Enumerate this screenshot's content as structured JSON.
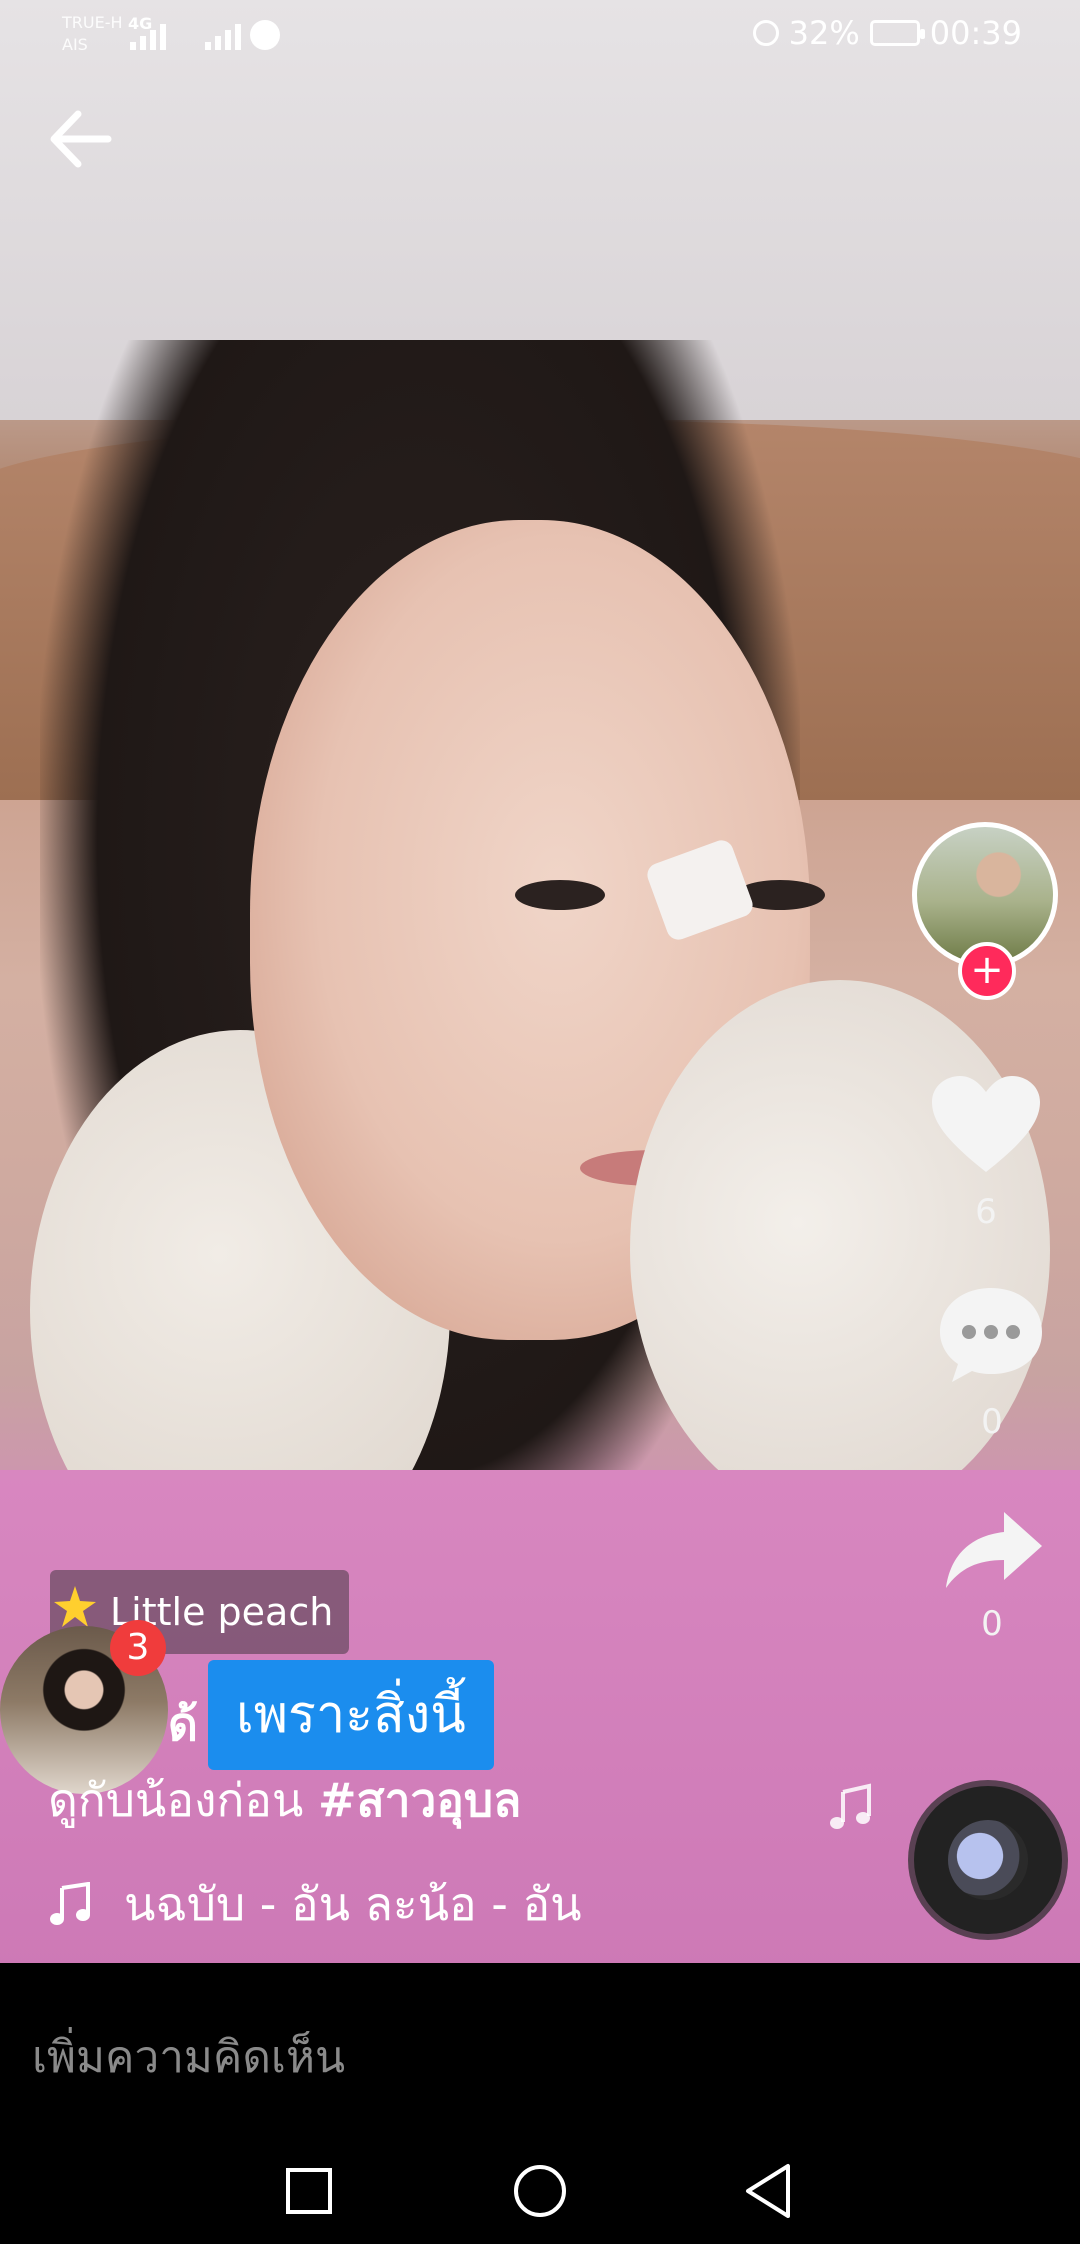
{
  "status_bar": {
    "carrier_1": "TRUE-H",
    "carrier_2": "AIS",
    "network": "4G",
    "battery": "32%",
    "time": "00:39"
  },
  "video": {
    "effect_label": "Little peach",
    "notification_count": "3",
    "tooltip": "เพราะสิ่งนี้",
    "username": "ด้ ด",
    "caption_text": "ดูกับน้องก่อน ",
    "caption_hashtag": "#สาวอุบล",
    "song": "นฉบับ - อัน ละน้อ - อัน"
  },
  "actions": {
    "likes": "6",
    "comments": "0",
    "shares": "0"
  },
  "comment_bar": {
    "placeholder": "เพิ่มความคิดเห็น"
  }
}
